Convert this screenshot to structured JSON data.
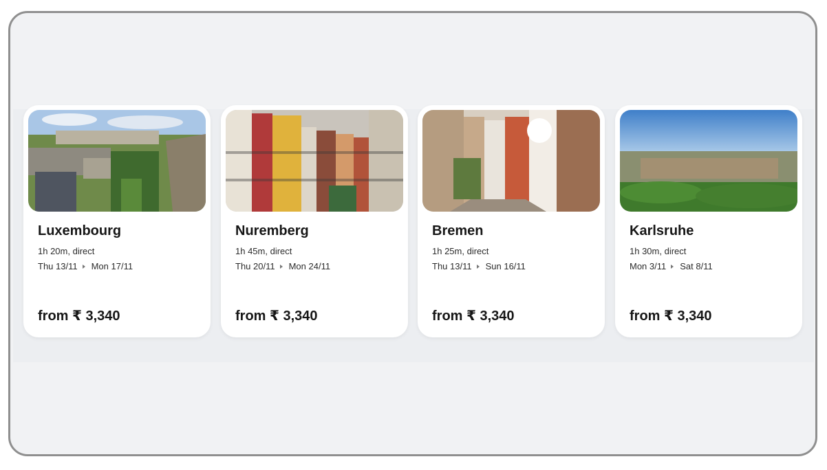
{
  "cards": [
    {
      "city": "Luxembourg",
      "duration": "1h 20m, direct",
      "depart": "Thu 13/11",
      "return": "Mon 17/11",
      "price": "from ₹ 3,340"
    },
    {
      "city": "Nuremberg",
      "duration": "1h 45m, direct",
      "depart": "Thu 20/11",
      "return": "Mon 24/11",
      "price": "from ₹ 3,340"
    },
    {
      "city": "Bremen",
      "duration": "1h 25m, direct",
      "depart": "Thu 13/11",
      "return": "Sun 16/11",
      "price": "from ₹ 3,340"
    },
    {
      "city": "Karlsruhe",
      "duration": "1h 30m, direct",
      "depart": "Mon 3/11",
      "return": "Sat 8/11",
      "price": "from ₹ 3,340"
    }
  ],
  "icons": {
    "date_separator": "arrow-right-icon"
  }
}
